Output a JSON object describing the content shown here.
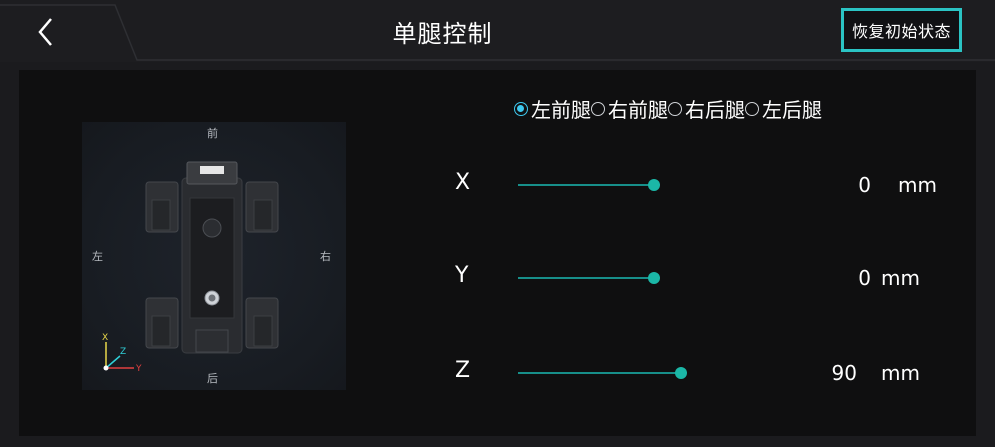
{
  "header": {
    "title": "单腿控制",
    "reset_label": "恢复初始状态"
  },
  "robot_view": {
    "front": "前",
    "left": "左",
    "right": "右",
    "back": "后",
    "axes": {
      "x": "X",
      "y": "Y",
      "z": "Z"
    }
  },
  "legs": [
    {
      "label": "左前腿",
      "selected": true
    },
    {
      "label": "右前腿",
      "selected": false
    },
    {
      "label": "右后腿",
      "selected": false
    },
    {
      "label": "左后腿",
      "selected": false
    }
  ],
  "controls": [
    {
      "axis": "X",
      "value": "0",
      "unit": "mm"
    },
    {
      "axis": "Y",
      "value": "0",
      "unit": "mm"
    },
    {
      "axis": "Z",
      "value": "90",
      "unit": "mm"
    }
  ],
  "colors": {
    "accent": "#2bc4c4",
    "slider_track": "#178f8a",
    "slider_thumb": "#1bb7a7",
    "radio_selected": "#3ec8ee",
    "axis_x": "#e8d84a",
    "axis_y": "#e04040",
    "axis_z": "#2fd0d8"
  }
}
